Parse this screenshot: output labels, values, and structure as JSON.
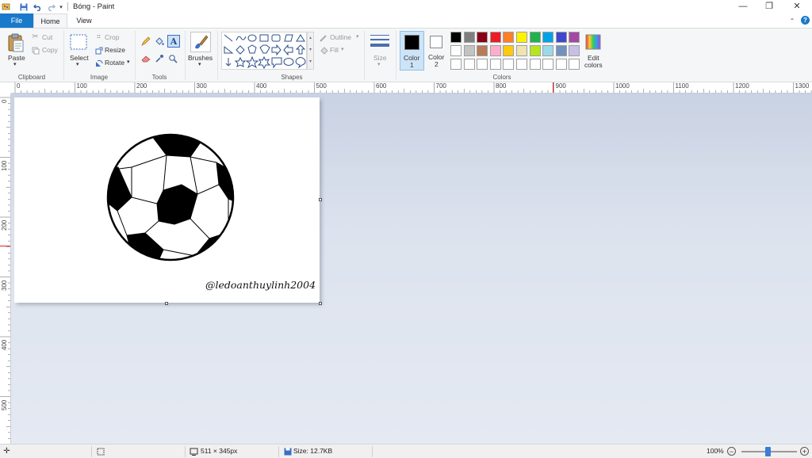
{
  "window": {
    "title": "Bóng - Paint",
    "minimize_glyph": "—",
    "restore_glyph": "❐",
    "close_glyph": "✕"
  },
  "tabs": [
    {
      "label": "File"
    },
    {
      "label": "Home"
    },
    {
      "label": "View"
    }
  ],
  "clipboard": {
    "paste": "Paste",
    "cut": "Cut",
    "copy": "Copy",
    "group": "Clipboard"
  },
  "image": {
    "select": "Select",
    "crop": "Crop",
    "resize": "Resize",
    "rotate": "Rotate",
    "group": "Image"
  },
  "tools": {
    "group": "Tools"
  },
  "brushes": {
    "label": "Brushes"
  },
  "shapes": {
    "outline": "Outline",
    "fill": "Fill",
    "group": "Shapes"
  },
  "size": {
    "label": "Size"
  },
  "colors": {
    "color1_label": "Color",
    "color1_num": "1",
    "color2_label": "Color",
    "color2_num": "2",
    "edit_label_1": "Edit",
    "edit_label_2": "colors",
    "group": "Colors",
    "color1": "#000000",
    "color2": "#ffffff",
    "palette_row1": [
      "#000000",
      "#7f7f7f",
      "#880015",
      "#ed1c24",
      "#ff7f27",
      "#fff200",
      "#22b14c",
      "#00a2e8",
      "#3f48cc",
      "#a349a4"
    ],
    "palette_row2": [
      "#ffffff",
      "#c3c3c3",
      "#b97a57",
      "#ffaec9",
      "#ffc90e",
      "#efe4b0",
      "#b5e61d",
      "#99d9ea",
      "#7092be",
      "#c8bfe7"
    ]
  },
  "ruler": {
    "h_labels": [
      "0",
      "100",
      "200",
      "300",
      "400",
      "500",
      "600",
      "700",
      "800",
      "900",
      "1000",
      "1100",
      "1200",
      "1300"
    ],
    "v_labels": [
      "0",
      "100",
      "200",
      "300",
      "400",
      "500"
    ]
  },
  "canvas": {
    "watermark": "@ledoanthuylinh2004"
  },
  "status": {
    "dimensions": "511 × 345px",
    "size": "Size: 12.7KB",
    "zoom": "100%"
  }
}
